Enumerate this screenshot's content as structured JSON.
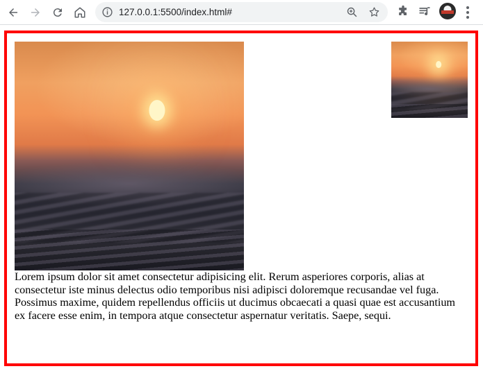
{
  "browser": {
    "url": "127.0.0.1:5500/index.html#",
    "icons": {
      "back": "arrow-left-icon",
      "forward": "arrow-right-icon",
      "reload": "reload-icon",
      "home": "home-icon",
      "site_info": "info-icon",
      "zoom": "zoom-icon",
      "bookmark": "star-icon",
      "extensions": "puzzle-icon",
      "media": "playlist-icon",
      "menu": "kebab-icon"
    }
  },
  "page": {
    "border_color": "#ff0000",
    "images": [
      {
        "name": "sunset-ocean-large",
        "description_icon": "image"
      },
      {
        "name": "sunset-ocean-small",
        "description_icon": "image"
      }
    ],
    "paragraph": "Lorem ipsum dolor sit amet consectetur adipisicing elit. Rerum asperiores corporis, alias at consectetur iste minus delectus odio temporibus nisi adipisci doloremque recusandae vel fuga. Possimus maxime, quidem repellendus officiis ut ducimus obcaecati a quasi quae est accusantium ex facere esse enim, in tempora atque consectetur aspernatur veritatis. Saepe, sequi."
  }
}
